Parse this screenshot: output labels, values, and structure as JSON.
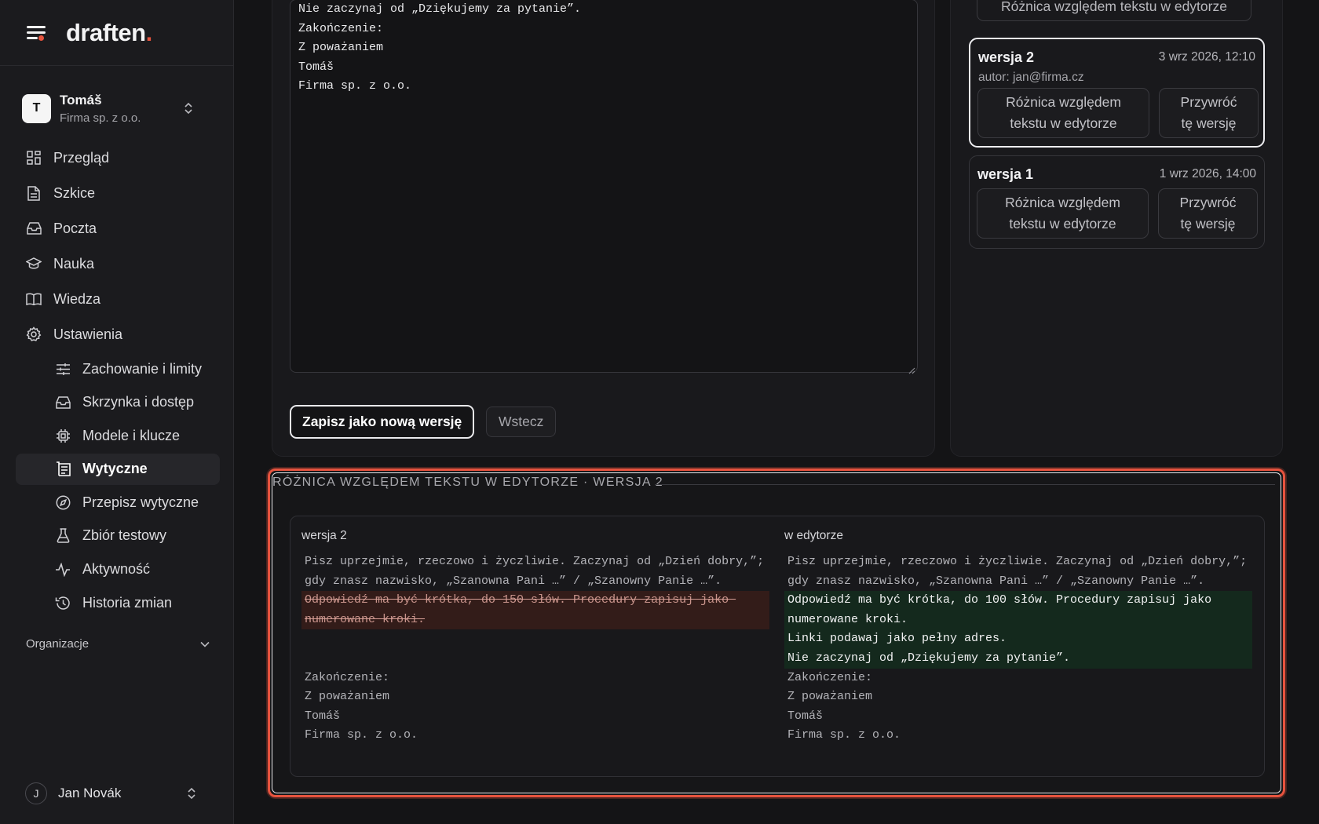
{
  "brand": {
    "logo_text": "draften",
    "logo_dot": ".",
    "accent": "#e5533d"
  },
  "org": {
    "initial": "T",
    "name": "Tomáš",
    "company": "Firma sp. z o.o."
  },
  "nav": {
    "main": [
      {
        "label": "Przegląd",
        "icon": "grid-icon"
      },
      {
        "label": "Szkice",
        "icon": "document-icon"
      },
      {
        "label": "Poczta",
        "icon": "inbox-icon"
      },
      {
        "label": "Nauka",
        "icon": "graduation-cap-icon"
      },
      {
        "label": "Wiedza",
        "icon": "book-icon"
      },
      {
        "label": "Ustawienia",
        "icon": "gear-icon"
      }
    ],
    "settings": [
      {
        "label": "Zachowanie i limity",
        "icon": "sliders-icon"
      },
      {
        "label": "Skrzynka i dostęp",
        "icon": "inbox-icon"
      },
      {
        "label": "Modele i klucze",
        "icon": "chip-icon"
      },
      {
        "label": "Wytyczne",
        "icon": "guidelines-icon",
        "active": true
      },
      {
        "label": "Przepisz wytyczne",
        "icon": "compass-icon"
      },
      {
        "label": "Zbiór testowy",
        "icon": "flask-icon"
      },
      {
        "label": "Aktywność",
        "icon": "activity-icon"
      },
      {
        "label": "Historia zmian",
        "icon": "history-icon"
      }
    ],
    "section_label": "Organizacje"
  },
  "user": {
    "initial": "J",
    "name": "Jan Novák"
  },
  "editor": {
    "lines": [
      "Nie zaczynaj od „Dziękujemy za pytanie”.",
      "Zakończenie:",
      "Z poważaniem",
      "Tomáš",
      "Firma sp. z o.o."
    ],
    "save_label": "Zapisz jako nową wersję",
    "back_label": "Wstecz"
  },
  "versions": {
    "top_diff_label": "Różnica względem tekstu w edytorze",
    "items": [
      {
        "name": "wersja 2",
        "date": "3 wrz 2026, 12:10",
        "author": "autor: jan@firma.cz",
        "diff_label": "Różnica względem tekstu w edytorze",
        "restore_label": "Przywróć tę wersję",
        "selected": true
      },
      {
        "name": "wersja 1",
        "date": "1 wrz 2026, 14:00",
        "diff_label": "Różnica względem tekstu w edytorze",
        "restore_label": "Przywróć tę wersję",
        "selected": false
      }
    ]
  },
  "diff": {
    "title": "Różnica względem tekstu w edytorze · wersja 2",
    "left_title": "wersja 2",
    "right_title": "w edytorze",
    "left": {
      "intro": "Pisz uprzejmie, rzeczowo i życzliwie. Zaczynaj od „Dzień dobry,”; gdy znasz nazwisko, „Szanowna Pani …” / „Szanowny Panie …”.",
      "removed": "Odpowiedź ma być krótka, do 150 słów. Procedury zapisuj jako numerowane kroki.",
      "closing": [
        "Zakończenie:",
        "Z poważaniem",
        "Tomáš",
        "Firma sp. z o.o."
      ]
    },
    "right": {
      "intro": "Pisz uprzejmie, rzeczowo i życzliwie. Zaczynaj od „Dzień dobry,”; gdy znasz nazwisko, „Szanowna Pani …” / „Szanowny Panie …”.",
      "added": [
        "Odpowiedź ma być krótka, do 100 słów. Procedury zapisuj jako numerowane kroki.",
        "Linki podawaj jako pełny adres.",
        "Nie zaczynaj od „Dziękujemy za pytanie”."
      ],
      "closing": [
        "Zakończenie:",
        "Z poważaniem",
        "Tomáš",
        "Firma sp. z o.o."
      ]
    },
    "colors": {
      "removed_bg": "#331c19",
      "added_bg": "#14291d",
      "highlight": "#e6533e"
    }
  }
}
